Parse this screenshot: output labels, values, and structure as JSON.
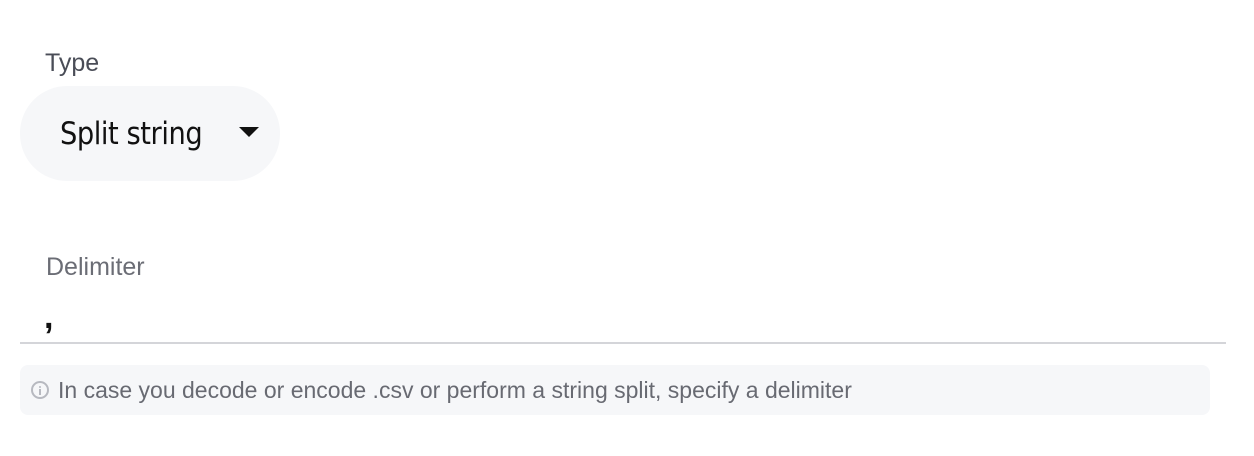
{
  "type_field": {
    "label": "Type",
    "selected_value": "Split string",
    "caret_icon": "caret-down-icon"
  },
  "delimiter_field": {
    "label": "Delimiter",
    "value": ","
  },
  "helper": {
    "icon": "info-icon",
    "text": "In case you decode or encode .csv or perform a string split, specify a delimiter"
  },
  "colors": {
    "field_background": "#f6f7f9",
    "underline": "#d4d5d9",
    "label_text": "#4a4d57",
    "helper_text": "#686a72"
  }
}
